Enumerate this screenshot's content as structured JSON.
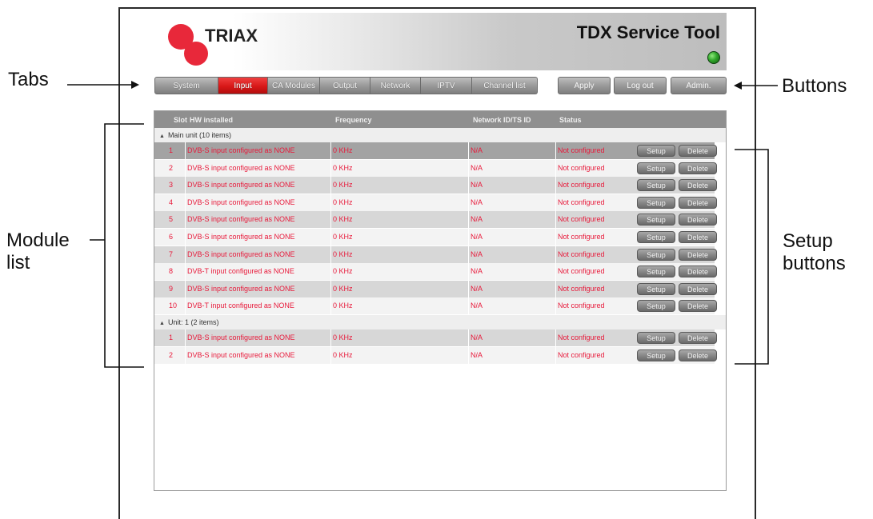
{
  "header": {
    "logo_text": "TRIAX",
    "app_title": "TDX Service Tool",
    "status_color": "#2fa52a"
  },
  "tabs": [
    {
      "label": "System"
    },
    {
      "label": "Input",
      "active": true
    },
    {
      "label": "CA Modules"
    },
    {
      "label": "Output"
    },
    {
      "label": "Network"
    },
    {
      "label": "IPTV"
    },
    {
      "label": "Channel list"
    }
  ],
  "buttons": {
    "apply": "Apply",
    "logout": "Log out",
    "admin": "Admin."
  },
  "table": {
    "columns": {
      "slot": "Slot",
      "hw": "HW installed",
      "frequency": "Frequency",
      "network": "Network ID/TS ID",
      "status": "Status"
    },
    "setup_label": "Setup",
    "delete_label": "Delete",
    "groups": [
      {
        "label": "Main unit (10 items)",
        "rows": [
          {
            "slot": "1",
            "hw": "DVB-S input configured as NONE",
            "frequency": "0 KHz",
            "network": "N/A",
            "status": "Not configured"
          },
          {
            "slot": "2",
            "hw": "DVB-S input configured as NONE",
            "frequency": "0 KHz",
            "network": "N/A",
            "status": "Not configured"
          },
          {
            "slot": "3",
            "hw": "DVB-S input configured as NONE",
            "frequency": "0 KHz",
            "network": "N/A",
            "status": "Not configured"
          },
          {
            "slot": "4",
            "hw": "DVB-S input configured as NONE",
            "frequency": "0 KHz",
            "network": "N/A",
            "status": "Not configured"
          },
          {
            "slot": "5",
            "hw": "DVB-S input configured as NONE",
            "frequency": "0 KHz",
            "network": "N/A",
            "status": "Not configured"
          },
          {
            "slot": "6",
            "hw": "DVB-S input configured as NONE",
            "frequency": "0 KHz",
            "network": "N/A",
            "status": "Not configured"
          },
          {
            "slot": "7",
            "hw": "DVB-S input configured as NONE",
            "frequency": "0 KHz",
            "network": "N/A",
            "status": "Not configured"
          },
          {
            "slot": "8",
            "hw": "DVB-T input configured as NONE",
            "frequency": "0 KHz",
            "network": "N/A",
            "status": "Not configured"
          },
          {
            "slot": "9",
            "hw": "DVB-S input configured as NONE",
            "frequency": "0 KHz",
            "network": "N/A",
            "status": "Not configured"
          },
          {
            "slot": "10",
            "hw": "DVB-T input configured as NONE",
            "frequency": "0 KHz",
            "network": "N/A",
            "status": "Not configured"
          }
        ]
      },
      {
        "label": "Unit: 1 (2 items)",
        "rows": [
          {
            "slot": "1",
            "hw": "DVB-S input configured as NONE",
            "frequency": "0 KHz",
            "network": "N/A",
            "status": "Not configured"
          },
          {
            "slot": "2",
            "hw": "DVB-S input configured as NONE",
            "frequency": "0 KHz",
            "network": "N/A",
            "status": "Not configured"
          }
        ]
      }
    ]
  },
  "annotations": {
    "tabs": "Tabs",
    "buttons": "Buttons",
    "module_list_line1": "Module",
    "module_list_line2": "list",
    "setup_buttons_line1": "Setup",
    "setup_buttons_line2": "buttons"
  }
}
